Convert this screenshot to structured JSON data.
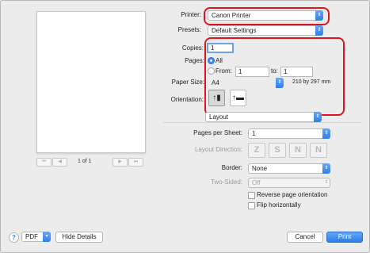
{
  "preview": {
    "page_info": "1 of 1",
    "nav": [
      "⏮",
      "◀",
      "▶",
      "⏭"
    ]
  },
  "printer": {
    "label": "Printer:",
    "value": "Canon Printer"
  },
  "presets": {
    "label": "Presets:",
    "value": "Default Settings"
  },
  "copies": {
    "label": "Copies:",
    "value": "1"
  },
  "pages": {
    "label": "Pages:",
    "all_label": "All",
    "from_label": "From:",
    "from_value": "1",
    "to_label": "to:",
    "to_value": "1"
  },
  "paper_size": {
    "label": "Paper Size:",
    "value": "A4",
    "dimensions": "210 by 297 mm"
  },
  "orientation": {
    "label": "Orientation:",
    "portrait_glyph": "↑▮",
    "landscape_glyph": "↑▬",
    "selected": "portrait"
  },
  "section_menu": {
    "value": "Layout"
  },
  "layout": {
    "pages_per_sheet_label": "Pages per Sheet:",
    "pages_per_sheet_value": "1",
    "layout_direction_label": "Layout Direction:",
    "direction_glyphs": [
      "Z",
      "S",
      "N",
      "N"
    ],
    "border_label": "Border:",
    "border_value": "None",
    "two_sided_label": "Two-Sided:",
    "two_sided_value": "Off",
    "reverse_label": "Reverse page orientation",
    "flip_label": "Flip horizontally"
  },
  "bottom": {
    "help_glyph": "?",
    "pdf_label": "PDF",
    "hide_details_label": "Hide Details",
    "cancel_label": "Cancel",
    "print_label": "Print"
  },
  "colors": {
    "accent": "#2f7ee8",
    "highlight_box": "#e0141e"
  }
}
